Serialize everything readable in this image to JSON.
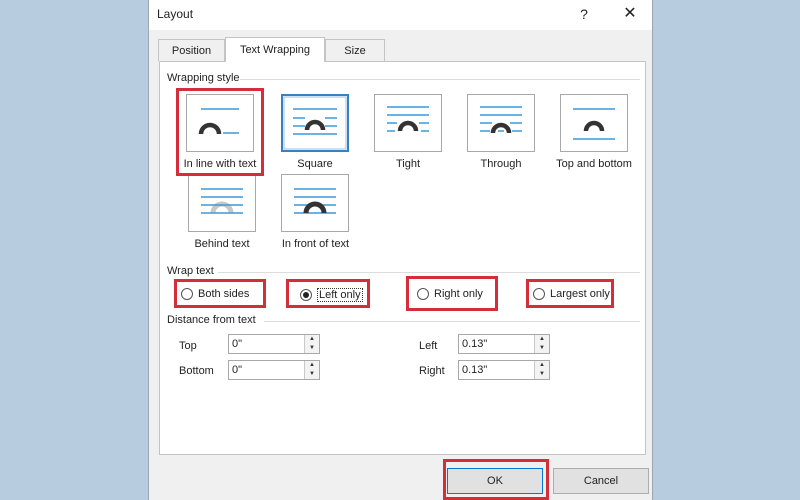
{
  "dialog": {
    "title": "Layout",
    "help": "?",
    "close": "✕"
  },
  "tabs": [
    {
      "label": "Position"
    },
    {
      "label": "Text Wrapping"
    },
    {
      "label": "Size"
    }
  ],
  "wrapping_style": {
    "label": "Wrapping style",
    "options": [
      {
        "label": "In line with text"
      },
      {
        "label": "Square"
      },
      {
        "label": "Tight"
      },
      {
        "label": "Through"
      },
      {
        "label": "Top and bottom"
      },
      {
        "label": "Behind text"
      },
      {
        "label": "In front of text"
      }
    ],
    "selected": "Square"
  },
  "wrap_text": {
    "label": "Wrap text",
    "options": [
      {
        "label": "Both sides"
      },
      {
        "label": "Left only"
      },
      {
        "label": "Right only"
      },
      {
        "label": "Largest only"
      }
    ],
    "selected": "Left only"
  },
  "distance": {
    "label": "Distance from text",
    "top": {
      "label": "Top",
      "value": "0\""
    },
    "bottom": {
      "label": "Bottom",
      "value": "0\""
    },
    "left": {
      "label": "Left",
      "value": "0.13\""
    },
    "right": {
      "label": "Right",
      "value": "0.13\""
    }
  },
  "buttons": {
    "ok": "OK",
    "cancel": "Cancel"
  },
  "colors": {
    "highlight": "#d42e3a",
    "accent": "#3a7fbf",
    "line": "#3a9ad9"
  }
}
